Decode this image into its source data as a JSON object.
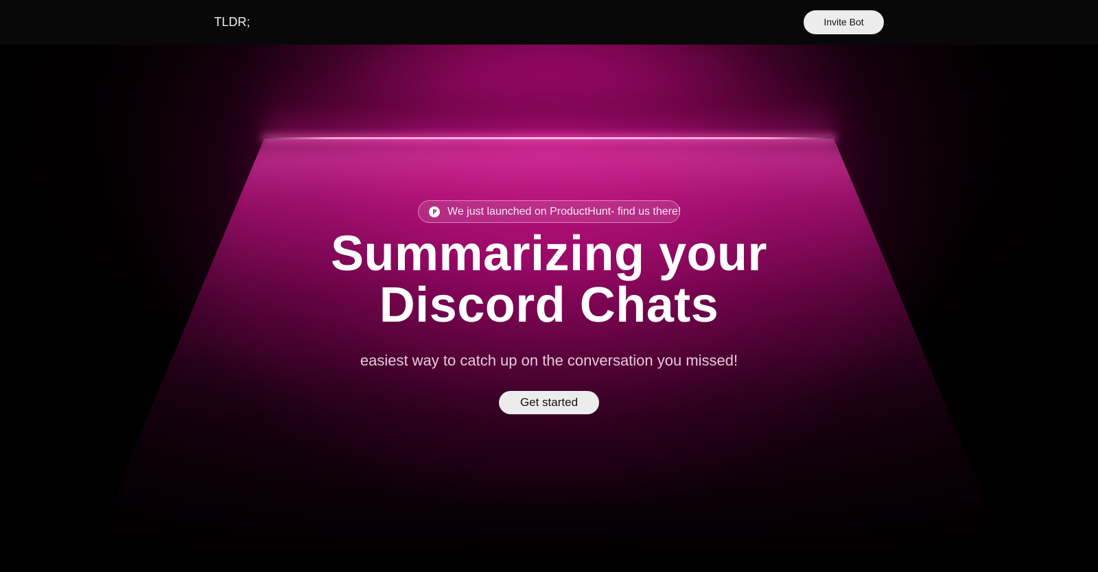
{
  "nav": {
    "brand": "TLDR;",
    "invite_label": "Invite Bot"
  },
  "hero": {
    "announcement": {
      "icon": "producthunt-icon",
      "text": "We just launched on ProductHunt- find us there!"
    },
    "headline_line1": "Summarizing your",
    "headline_line2": "Discord Chats",
    "subtitle": "easiest way to catch up on the conversation you missed!",
    "cta_label": "Get started"
  },
  "colors": {
    "background": "#000000",
    "navbar": "#080808",
    "glow_accent": "#b40c78",
    "light_line": "#ffbee8",
    "button_bg": "#ececec",
    "button_text": "#111111"
  }
}
